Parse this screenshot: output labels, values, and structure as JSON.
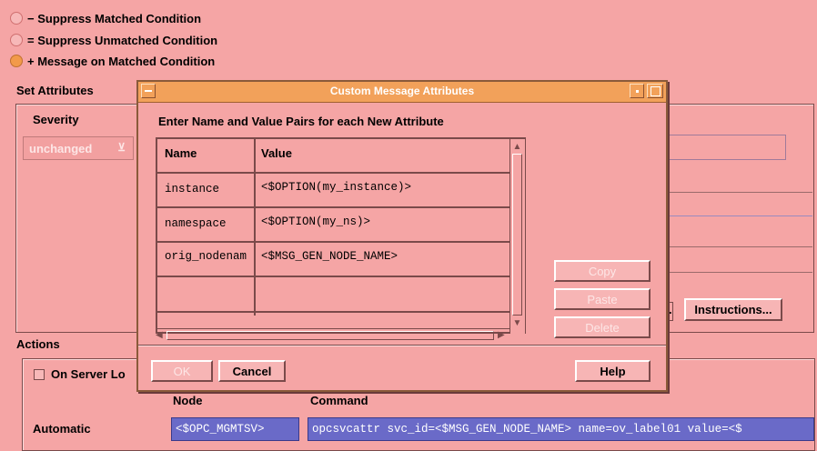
{
  "options": {
    "suppress_matched": "− Suppress Matched Condition",
    "suppress_unmatched": "= Suppress Unmatched Condition",
    "message_on_matched": "+ Message on Matched Condition"
  },
  "set_attributes": {
    "heading": "Set Attributes",
    "severity_label": "Severity",
    "severity_value": "unchanged",
    "instructions_button": "Instructions..."
  },
  "actions": {
    "heading": "Actions",
    "on_server_log": "On Server Lo",
    "node_header": "Node",
    "command_header": "Command",
    "automatic_label": "Automatic",
    "automatic_node": "<$OPC_MGMTSV>",
    "automatic_command": "opcsvcattr svc_id=<$MSG_GEN_NODE_NAME> name=ov_label01 value=<$"
  },
  "dialog": {
    "title": "Custom Message Attributes",
    "instruction": "Enter Name and Value Pairs for each New Attribute",
    "columns": [
      "Name",
      "Value"
    ],
    "rows": [
      {
        "name": "instance",
        "value": "<$OPTION(my_instance)>"
      },
      {
        "name": "namespace",
        "value": "<$OPTION(my_ns)>"
      },
      {
        "name": "orig_nodenam",
        "value": "<$MSG_GEN_NODE_NAME>"
      },
      {
        "name": "",
        "value": ""
      },
      {
        "name": "",
        "value": ""
      }
    ],
    "copy_button": "Copy",
    "paste_button": "Paste",
    "delete_button": "Delete",
    "ok_button": "OK",
    "cancel_button": "Cancel",
    "help_button": "Help"
  }
}
